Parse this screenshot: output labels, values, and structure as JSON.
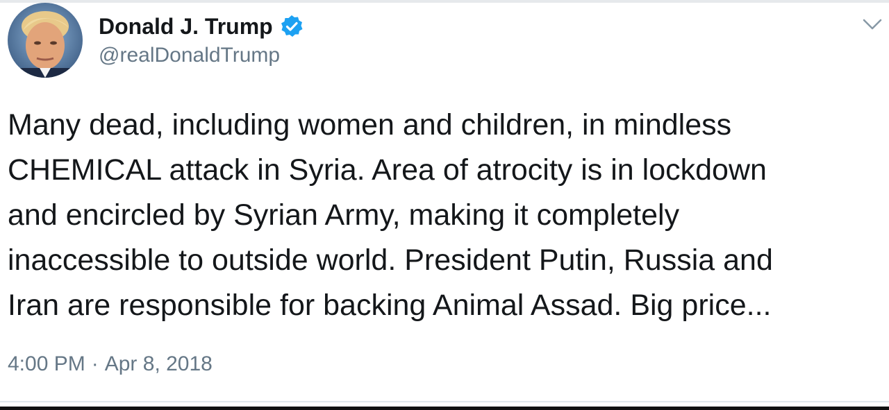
{
  "author": {
    "display_name": "Donald J. Trump",
    "handle": "@realDonaldTrump",
    "verified": true,
    "avatar_icon": "profile-photo"
  },
  "icons": {
    "verified": "verified-badge-icon",
    "menu": "chevron-down-icon"
  },
  "tweet": {
    "text_lines": [
      "Many dead, including women and children, in mindless",
      "CHEMICAL attack in Syria. Area of atrocity is in lockdown",
      "and encircled by Syrian Army, making it completely",
      "inaccessible to outside world. President Putin, Russia and",
      "Iran are responsible for backing Animal Assad. Big price..."
    ],
    "time": "4:00 PM",
    "separator": "·",
    "date": "Apr 8, 2018"
  },
  "colors": {
    "text": "#14171a",
    "secondary": "#657786",
    "verified_blue": "#1da1f2",
    "divider": "#e1e8ed"
  }
}
